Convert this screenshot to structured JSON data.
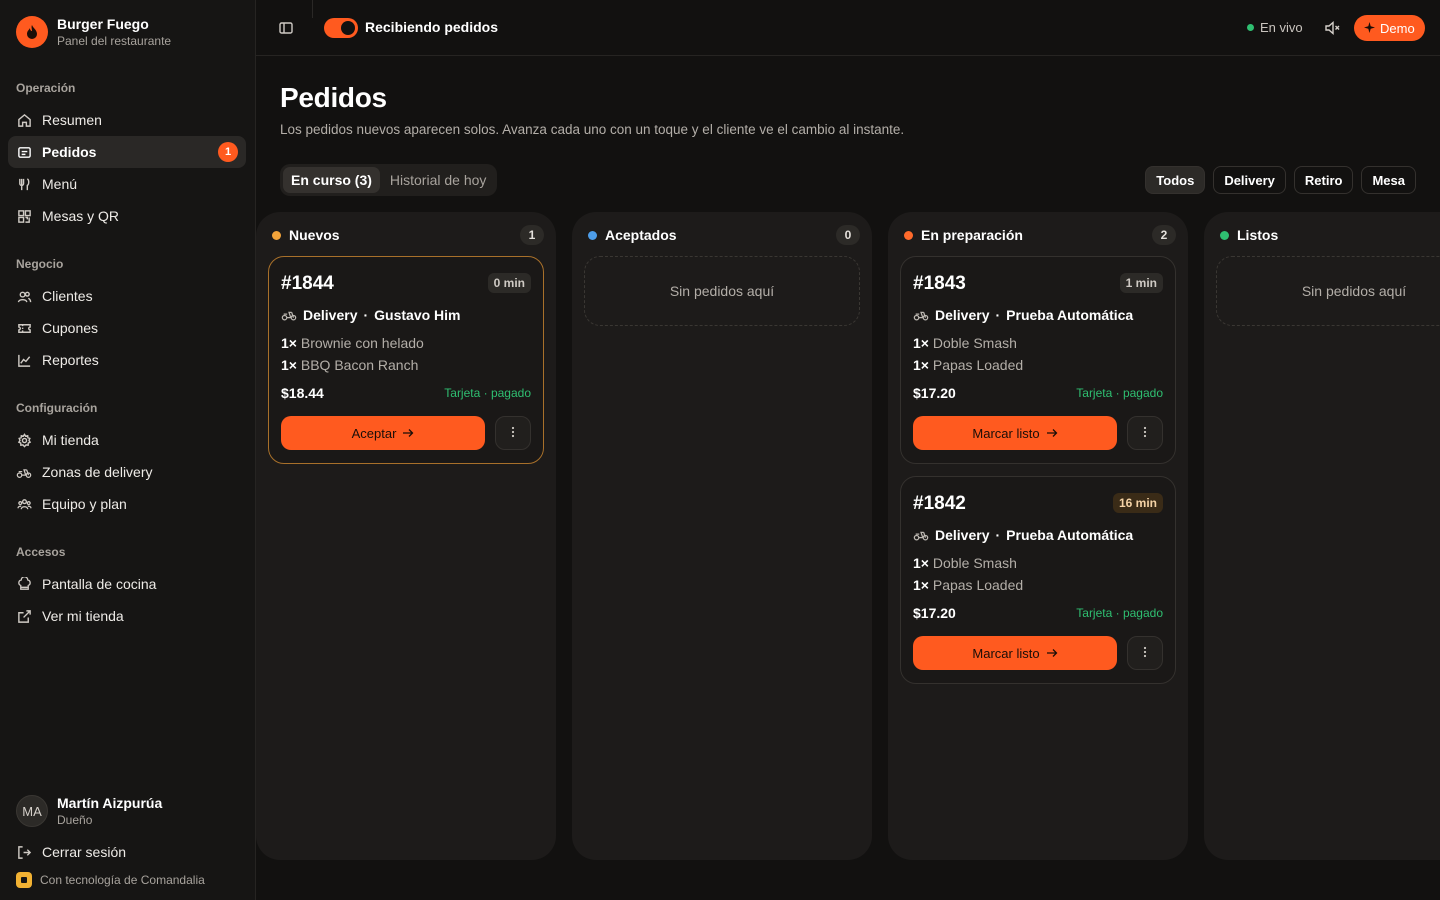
{
  "brand": {
    "name": "Burger Fuego",
    "subtitle": "Panel del restaurante"
  },
  "sidebar": {
    "sections": [
      {
        "title": "Operación",
        "items": [
          {
            "label": "Resumen",
            "icon": "home-icon"
          },
          {
            "label": "Pedidos",
            "icon": "receipt-icon",
            "active": true,
            "badge": "1"
          },
          {
            "label": "Menú",
            "icon": "utensils-icon"
          },
          {
            "label": "Mesas y QR",
            "icon": "qr-icon"
          }
        ]
      },
      {
        "title": "Negocio",
        "items": [
          {
            "label": "Clientes",
            "icon": "users-icon"
          },
          {
            "label": "Cupones",
            "icon": "ticket-icon"
          },
          {
            "label": "Reportes",
            "icon": "chart-line-icon"
          }
        ]
      },
      {
        "title": "Configuración",
        "items": [
          {
            "label": "Mi tienda",
            "icon": "gear-icon"
          },
          {
            "label": "Zonas de delivery",
            "icon": "scooter-icon"
          },
          {
            "label": "Equipo y plan",
            "icon": "team-icon"
          }
        ]
      },
      {
        "title": "Accesos",
        "items": [
          {
            "label": "Pantalla de cocina",
            "icon": "chef-hat-icon"
          },
          {
            "label": "Ver mi tienda",
            "icon": "external-link-icon"
          }
        ]
      }
    ],
    "user": {
      "initials": "MA",
      "name": "Martín Aizpurúa",
      "role": "Dueño"
    },
    "logout_label": "Cerrar sesión",
    "powered_by": "Con tecnología de Comandalia"
  },
  "topbar": {
    "receiving_label": "Recibiendo pedidos",
    "receiving_on": true,
    "live_label": "En vivo",
    "demo_label": "Demo"
  },
  "page": {
    "title": "Pedidos",
    "subtitle": "Los pedidos nuevos aparecen solos. Avanza cada uno con un toque y el cliente ve el cambio al instante.",
    "tabs": [
      {
        "label": "En curso (3)",
        "active": true
      },
      {
        "label": "Historial de hoy",
        "active": false
      }
    ],
    "filters": [
      {
        "label": "Todos",
        "active": true
      },
      {
        "label": "Delivery",
        "active": false
      },
      {
        "label": "Retiro",
        "active": false
      },
      {
        "label": "Mesa",
        "active": false
      }
    ]
  },
  "columns": [
    {
      "title": "Nuevos",
      "count": "1",
      "color": "#f2a33a"
    },
    {
      "title": "Aceptados",
      "count": "0",
      "color": "#4d9de8",
      "empty_label": "Sin pedidos aquí"
    },
    {
      "title": "En preparación",
      "count": "2",
      "color": "#ff6a2b"
    },
    {
      "title": "Listos",
      "color": "#2fbf71",
      "empty_label": "Sin pedidos aquí"
    }
  ],
  "orders": [
    {
      "id": "#1844",
      "time": "0 min",
      "type": "Delivery",
      "customer": "Gustavo Him",
      "items": [
        {
          "qty": "1×",
          "name": "Brownie con helado"
        },
        {
          "qty": "1×",
          "name": "BBQ Bacon Ranch"
        }
      ],
      "total": "$18.44",
      "payment": "Tarjeta · pagado",
      "action": "Aceptar"
    },
    {
      "id": "#1843",
      "time": "1 min",
      "type": "Delivery",
      "customer": "Prueba Automática",
      "items": [
        {
          "qty": "1×",
          "name": "Doble Smash"
        },
        {
          "qty": "1×",
          "name": "Papas Loaded"
        }
      ],
      "total": "$17.20",
      "payment": "Tarjeta · pagado",
      "action": "Marcar listo"
    },
    {
      "id": "#1842",
      "time": "16 min",
      "type": "Delivery",
      "customer": "Prueba Automática",
      "items": [
        {
          "qty": "1×",
          "name": "Doble Smash"
        },
        {
          "qty": "1×",
          "name": "Papas Loaded"
        }
      ],
      "total": "$17.20",
      "payment": "Tarjeta · pagado",
      "action": "Marcar listo"
    }
  ]
}
